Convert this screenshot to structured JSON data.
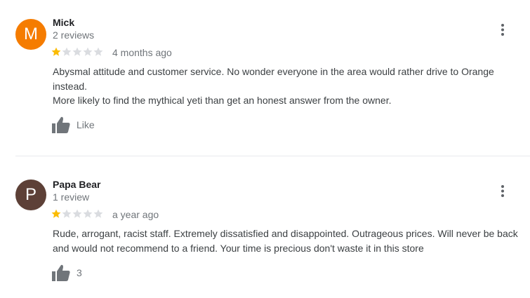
{
  "colors": {
    "star_filled": "#fbbc04",
    "star_empty": "#dadce0",
    "meta_text": "#70757a",
    "icon": "#70757a"
  },
  "reviews": [
    {
      "avatar_letter": "M",
      "avatar_color": "#f57c00",
      "author": "Mick",
      "author_meta": "2 reviews",
      "rating": 1,
      "rating_max": 5,
      "date": "4 months ago",
      "text_lines": [
        "Abysmal attitude and customer service. No wonder everyone in the area would rather drive to Orange instead.",
        "More likely to find the mythical yeti than get an honest answer from the owner."
      ],
      "like_label": "Like",
      "like_icon": "thumb-up-icon",
      "more_icon": "more-vert-icon"
    },
    {
      "avatar_letter": "P",
      "avatar_color": "#5d4037",
      "author": "Papa Bear",
      "author_meta": "1 review",
      "rating": 1,
      "rating_max": 5,
      "date": "a year ago",
      "text_lines": [
        "Rude, arrogant, racist staff. Extremely dissatisfied and disappointed. Outrageous prices. Will never be back and would not recommend to a friend. Your time is precious don't waste it in this store"
      ],
      "like_label": "3",
      "like_icon": "thumb-up-icon",
      "more_icon": "more-vert-icon"
    }
  ]
}
